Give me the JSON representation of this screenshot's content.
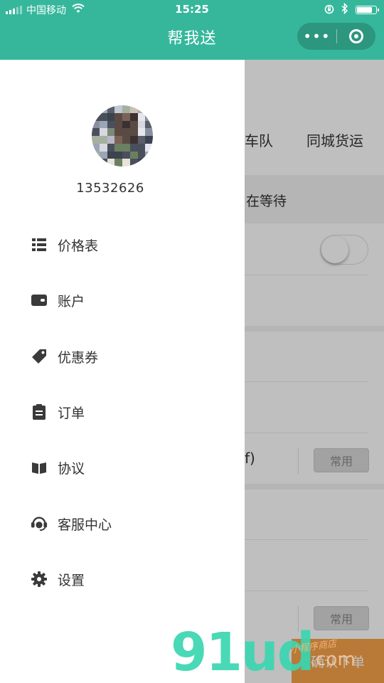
{
  "status_bar": {
    "carrier": "中国移动",
    "time": "15:25",
    "battery_level": 0.85
  },
  "nav": {
    "title": "帮我送",
    "more_label": "•••"
  },
  "drawer": {
    "phone": "13532626",
    "menu": [
      {
        "label": "价格表",
        "icon": "list-icon"
      },
      {
        "label": "账户",
        "icon": "wallet-icon"
      },
      {
        "label": "优惠券",
        "icon": "tag-icon"
      },
      {
        "label": "订单",
        "icon": "clipboard-icon"
      },
      {
        "label": "协议",
        "icon": "book-icon"
      },
      {
        "label": "客服中心",
        "icon": "headset-icon"
      },
      {
        "label": "设置",
        "icon": "gear-icon"
      }
    ]
  },
  "background_page": {
    "tab_partial": "车队",
    "tab_city_freight": "同城货运",
    "waiting_partial": "在等待",
    "paren_partial": "f)",
    "common_label_1": "常用",
    "common_label_2": "常用",
    "confirm_label": "确认下单"
  },
  "watermark": {
    "logo": "91ud",
    "sub": "小程序商店",
    "com": ".com"
  },
  "colors": {
    "brand_green": "#36b79c",
    "confirm_orange": "#f7a24a"
  }
}
